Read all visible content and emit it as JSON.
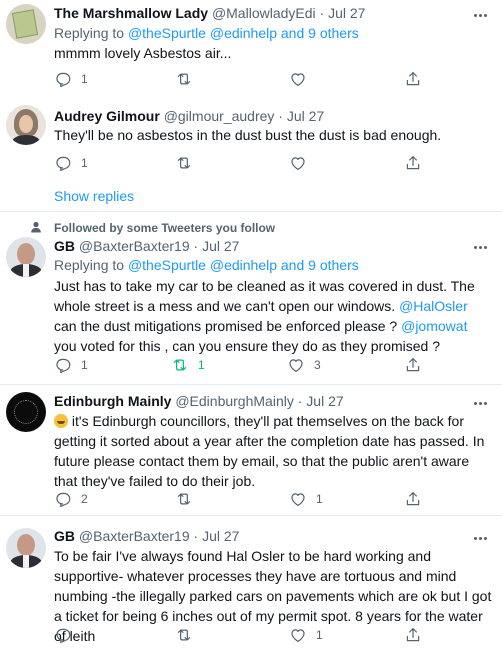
{
  "tweets": [
    {
      "name": "The Marshmallow Lady",
      "handle": "@MallowladyEdi",
      "sep": "·",
      "time": "Jul 27",
      "replying_prefix": "Replying to",
      "replying_handles": "@theSpurtle @edinhelp and 9 others",
      "text": "mmmm lovely Asbestos air...",
      "reply_count": "1",
      "retweet_count": "",
      "like_count": "",
      "avatar_icon": "stack-of-papers-avatar"
    },
    {
      "name": "Audrey Gilmour",
      "handle": "@gilmour_audrey",
      "sep": "·",
      "time": "Jul 27",
      "text": "They'll be no asbestos in the dust bust the dust is bad enough.",
      "reply_count": "1",
      "retweet_count": "",
      "like_count": "",
      "show_replies": "Show replies",
      "avatar_icon": "woman-portrait-avatar"
    },
    {
      "social_context": "Followed by some Tweeters you follow",
      "name": "GB",
      "handle": "@BaxterBaxter19",
      "sep": "·",
      "time": "Jul 27",
      "replying_prefix": "Replying to",
      "replying_handles": "@theSpurtle @edinhelp and 9 others",
      "text_part1": "Just has to take my car to be cleaned as it was covered in dust. The whole street is a mess and we can't open our windows. ",
      "mention1": "@HalOsler",
      "text_part2": " can the dust mitigations promised be enforced please ? ",
      "mention2": "@jomowat",
      "text_part3": " you voted for this , can you ensure they do as they promised ?",
      "reply_count": "1",
      "retweet_count": "1",
      "like_count": "3",
      "avatar_icon": "man-portrait-avatar"
    },
    {
      "name": "Edinburgh Mainly",
      "handle": "@EdinburghMainly",
      "sep": "·",
      "time": "Jul 27",
      "text": " it's Edinburgh councillors, they'll pat themselves on the back for getting it sorted about a year after the completion date has passed. In future please contact them by email, so that the public aren't aware that they've failed to do their job.",
      "emoji": "rolling-on-floor-laughing-emoji",
      "reply_count": "2",
      "retweet_count": "",
      "like_count": "1",
      "avatar_icon": "black-circle-avatar"
    },
    {
      "name": "GB",
      "handle": "@BaxterBaxter19",
      "sep": "·",
      "time": "Jul 27",
      "text": "To be fair I've always found Hal Osler to be hard working and supportive- whatever processes they have are tortuous and mind numbing -the illegally parked cars on pavements which are ok but I got a ticket for being 6 inches out of my permit spot. 8 years for the water of leith",
      "reply_count": "",
      "retweet_count": "",
      "like_count": "1",
      "avatar_icon": "man-portrait-avatar"
    }
  ],
  "colors": {
    "text": "#0f1419",
    "secondary": "#536471",
    "link": "#1d9bf0",
    "retweet_active": "#00ba7c",
    "divider": "#e6ecf0"
  }
}
